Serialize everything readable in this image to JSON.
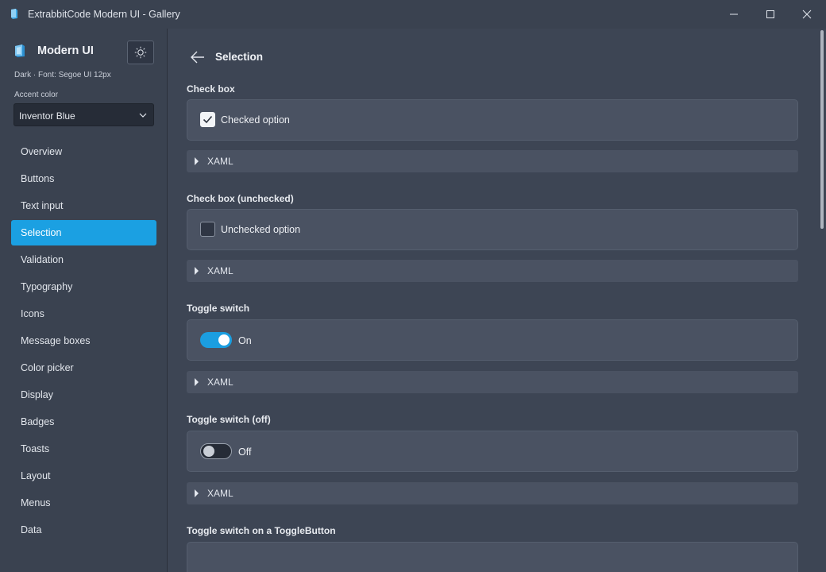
{
  "window": {
    "title": "ExtrabbitCode Modern UI - Gallery",
    "accent_color": "#1ba0e2"
  },
  "sidebar": {
    "brand": "Modern UI",
    "theme_info": "Dark · Font: Segoe UI 12px",
    "accent_label": "Accent color",
    "accent_value": "Inventor Blue",
    "items": [
      {
        "label": "Overview"
      },
      {
        "label": "Buttons"
      },
      {
        "label": "Text input"
      },
      {
        "label": "Selection",
        "active": true
      },
      {
        "label": "Validation"
      },
      {
        "label": "Typography"
      },
      {
        "label": "Icons"
      },
      {
        "label": "Message boxes"
      },
      {
        "label": "Color picker"
      },
      {
        "label": "Display"
      },
      {
        "label": "Badges"
      },
      {
        "label": "Toasts"
      },
      {
        "label": "Layout"
      },
      {
        "label": "Menus"
      },
      {
        "label": "Data"
      }
    ]
  },
  "main": {
    "title": "Selection",
    "xaml_label": "XAML",
    "sections": [
      {
        "title": "Check box",
        "label": "Checked option"
      },
      {
        "title": "Check box (unchecked)",
        "label": "Unchecked option"
      },
      {
        "title": "Toggle switch",
        "label": "On"
      },
      {
        "title": "Toggle switch (off)",
        "label": "Off"
      },
      {
        "title": "Toggle switch on a ToggleButton"
      }
    ]
  }
}
